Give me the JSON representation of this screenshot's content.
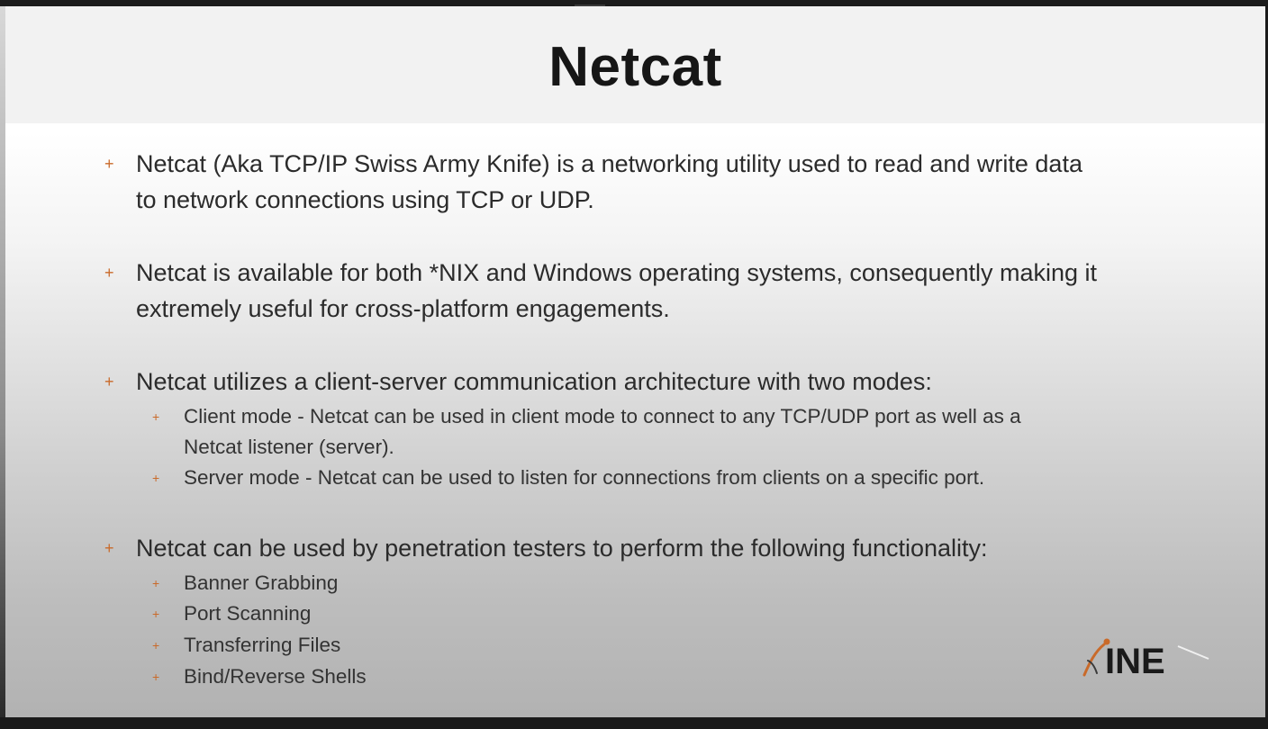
{
  "slide": {
    "title": "Netcat",
    "bullet_marker": "+",
    "points": [
      {
        "lines": [
          "Netcat (Aka TCP/IP Swiss Army Knife) is a networking utility used to read and write data",
          "to network connections using TCP or UDP."
        ]
      },
      {
        "lines": [
          "Netcat is available for both *NIX and Windows operating systems, consequently making it",
          "extremely useful for cross-platform engagements."
        ]
      },
      {
        "lines": [
          "Netcat utilizes a client-server communication architecture with two modes:"
        ],
        "sub": [
          {
            "lines": [
              "Client mode - Netcat can be used in client mode to connect to any TCP/UDP port as well as a",
              "Netcat listener (server)."
            ]
          },
          {
            "lines": [
              "Server mode - Netcat can be used to listen for connections from clients on a specific port."
            ]
          }
        ]
      },
      {
        "lines": [
          "Netcat can be used by penetration testers to perform the following functionality:"
        ],
        "sub": [
          {
            "lines": [
              "Banner Grabbing"
            ]
          },
          {
            "lines": [
              "Port Scanning"
            ]
          },
          {
            "lines": [
              "Transferring Files"
            ]
          },
          {
            "lines": [
              "Bind/Reverse Shells"
            ]
          }
        ]
      }
    ]
  },
  "logo": {
    "text": "INE",
    "icon": "ine-logo-icon",
    "color": "#1a1a1a",
    "accent_color": "#c96a2a"
  },
  "colors": {
    "bullet_accent": "#c96a2a",
    "title": "#161616",
    "body_text": "#2b2b2b"
  }
}
